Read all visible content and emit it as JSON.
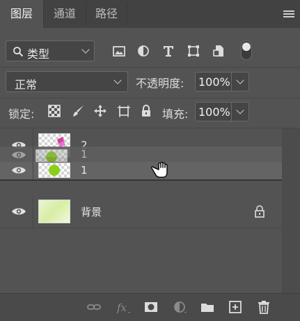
{
  "tabs": [
    {
      "label": "图层",
      "active": true
    },
    {
      "label": "通道",
      "active": false
    },
    {
      "label": "路径",
      "active": false
    }
  ],
  "filter": {
    "label": "类型"
  },
  "blend_mode": {
    "label": "正常"
  },
  "opacity": {
    "label": "不透明度:",
    "value": "100%"
  },
  "lock": {
    "label": "锁定:"
  },
  "fill": {
    "label": "填充:",
    "value": "100%"
  },
  "layers": [
    {
      "name": "2",
      "visible": true,
      "kind": "pink-shape"
    },
    {
      "name": "1",
      "visible": true,
      "kind": "green-circle",
      "dragging": true
    },
    {
      "name": "1",
      "visible": true,
      "kind": "green-circle"
    },
    {
      "name": "背景",
      "visible": true,
      "kind": "background",
      "locked": true
    }
  ],
  "colors": {
    "panel": "#535353",
    "tabbar": "#424242",
    "accent_green": "#8ccf1a",
    "accent_pink": "#d63fa8"
  },
  "bottom_icons": [
    "link-layers-icon",
    "fx-icon",
    "mask-icon",
    "adjustment-icon",
    "folder-icon",
    "new-layer-icon",
    "trash-icon"
  ]
}
